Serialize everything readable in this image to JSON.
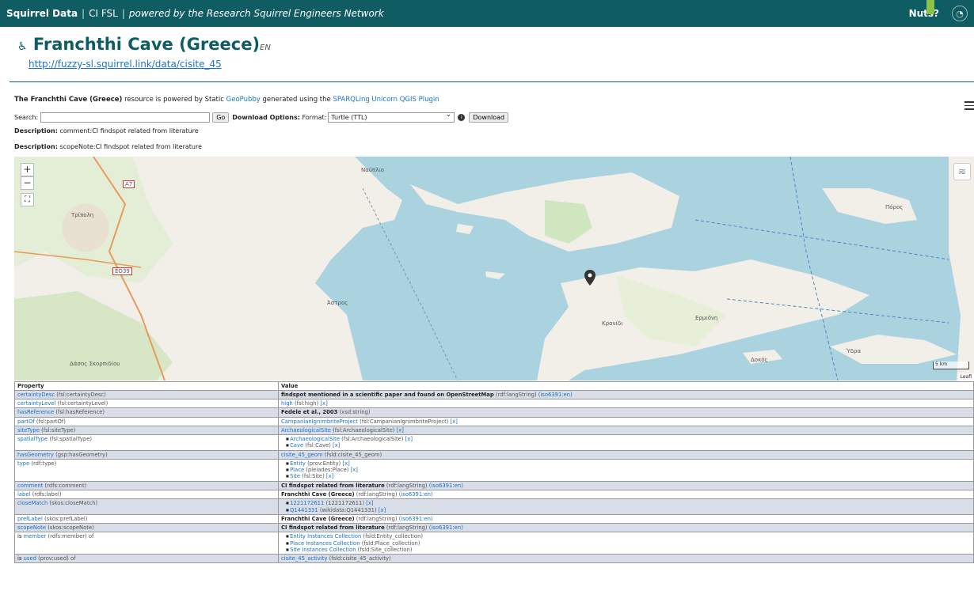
{
  "header": {
    "brand": "Squirrel Data",
    "project": "CI FSL",
    "tagline": "powered by the Research Squirrel Engineers Network",
    "nuts": "Nuts?"
  },
  "page": {
    "title": "Franchthi Cave (Greece)",
    "lang": "EN",
    "uri": "http://fuzzy-sl.squirrel.link/data/cisite_45",
    "powered_prefix": "The Franchthi Cave (Greece)",
    "powered_mid": " resource is powered by Static ",
    "geopubby": "GeoPubby",
    "powered_gen": " generated using the ",
    "plugin": "SPARQLing Unicorn QGIS Plugin"
  },
  "search": {
    "label": "Search:",
    "go": "Go",
    "download_options": "Download Options:",
    "format_label": "Format:",
    "format_value": "Turtle (TTL)",
    "download": "Download"
  },
  "descriptions": [
    {
      "label": "Description:",
      "text": " comment:CI findspot related from literature"
    },
    {
      "label": "Description:",
      "text": " scopeNote:CI findspot related from literature"
    }
  ],
  "map": {
    "zoom_in": "+",
    "zoom_out": "−",
    "fullscreen": "⛶",
    "scale": "5 km",
    "attribution": "Leafl",
    "labels": [
      "Τρίπολη",
      "Ναύπλιο",
      "Άστρος",
      "Κρανίδι",
      "Ερμιόνη",
      "Πόρος",
      "Ύδρα",
      "Δοκός",
      "Δάσος Σκορπιδίου",
      "A7",
      "EO39"
    ],
    "water_color": "#aad3df",
    "land_color": "#f2efe9"
  },
  "table": {
    "headers": [
      "Property",
      "Value"
    ],
    "rows": [
      {
        "prop": "certaintyDesc",
        "prop_type": " (fsl:certaintyDesc)",
        "values": [
          {
            "text": "findspot mentioned in a scientific paper and found on OpenStreetMap",
            "dt": " (rdf:langString) ",
            "lang": "(iso6391:en)"
          }
        ],
        "list": false,
        "bold": true
      },
      {
        "prop": "certaintyLevel",
        "prop_type": " (fsl:certaintyLevel)",
        "values": [
          {
            "link": "high",
            "dt": " (fsl:high) ",
            "x": "[x]"
          }
        ],
        "list": false
      },
      {
        "prop": "hasReference",
        "prop_type": " (fsl:hasReference)",
        "values": [
          {
            "text": "Fedele et al., 2003",
            "dt": " (xsd:string)"
          }
        ],
        "list": false,
        "bold": true
      },
      {
        "prop": "partOf",
        "prop_type": " (fsl:partOf)",
        "values": [
          {
            "link": "CampanianIgnimbriteProject",
            "dt": " (fsl:CampanianIgnimbriteProject) ",
            "x": "[x]"
          }
        ],
        "list": false
      },
      {
        "prop": "siteType",
        "prop_type": " (fsl:siteType)",
        "values": [
          {
            "link": "ArchaeologicalSite",
            "dt": " (fsl:ArchaeologicalSite) ",
            "x": "[x]"
          }
        ],
        "list": false
      },
      {
        "prop": "spatialType",
        "prop_type": " (fsl:spatialType)",
        "values": [
          {
            "link": "ArchaeologicalSite",
            "dt": " (fsl:ArchaeologicalSite) ",
            "x": "[x]"
          },
          {
            "link": "Cave",
            "dt": " (fsl:Cave) ",
            "x": "[x]"
          }
        ],
        "list": true
      },
      {
        "prop": "hasGeometry",
        "prop_type": " (gsp:hasGeometry)",
        "values": [
          {
            "link": "cisite_45_geom",
            "dt": " (fsld:cisite_45_geom)"
          }
        ],
        "list": false
      },
      {
        "prop": "type",
        "prop_type": " (rdf:type)",
        "values": [
          {
            "link": "Entity",
            "dt": " (prov:Entity) ",
            "x": "[x]"
          },
          {
            "link": "Place",
            "dt": " (pleiades:Place) ",
            "x": "[x]"
          },
          {
            "link": "Site",
            "dt": " (fsl:Site) ",
            "x": "[x]"
          }
        ],
        "list": true
      },
      {
        "prop": "comment",
        "prop_type": " (rdfs:comment)",
        "values": [
          {
            "text": "CI findspot related from literature",
            "dt": " (rdf:langString) ",
            "lang": "(iso6391:en)"
          }
        ],
        "list": false,
        "bold": true
      },
      {
        "prop": "label",
        "prop_type": " (rdfs:label)",
        "values": [
          {
            "text": "Franchthi Cave (Greece)",
            "dt": " (rdf:langString) ",
            "lang": "(iso6391:en)"
          }
        ],
        "list": false,
        "bold": true
      },
      {
        "prop": "closeMatch",
        "prop_type": " (skos:closeMatch)",
        "values": [
          {
            "link": "1221172611",
            "dt": " (1221172611) ",
            "x": "[x]"
          },
          {
            "link": "Q1441331",
            "dt": " (wikidata:Q1441331) ",
            "x": "[x]"
          }
        ],
        "list": true
      },
      {
        "prop": "prefLabel",
        "prop_type": " (skos:prefLabel)",
        "values": [
          {
            "text": "Franchthi Cave (Greece)",
            "dt": " (rdf:langString) ",
            "lang": "(iso6391:en)"
          }
        ],
        "list": false,
        "bold": true
      },
      {
        "prop": "scopeNote",
        "prop_type": " (skos:scopeNote)",
        "values": [
          {
            "text": "CI findspot related from literature",
            "dt": " (rdf:langString) ",
            "lang": "(iso6391:en)"
          }
        ],
        "list": false,
        "bold": true
      },
      {
        "prop_pre": "is ",
        "prop": "member",
        "prop_type": " (rdfs:member) of",
        "values": [
          {
            "link": "Entity Instances Collection",
            "dt": " (fsld:Entity_collection)"
          },
          {
            "link": "Place Instances Collection",
            "dt": " (fsld:Place_collection)"
          },
          {
            "link": "Site Instances Collection",
            "dt": " (fsld:Site_collection)"
          }
        ],
        "list": true
      },
      {
        "prop_pre": "is ",
        "prop": "used",
        "prop_type": " (prov:used) of",
        "values": [
          {
            "link": "cisite_45_activity",
            "dt": " (fsld:cisite_45_activity)"
          }
        ],
        "list": false
      }
    ]
  }
}
